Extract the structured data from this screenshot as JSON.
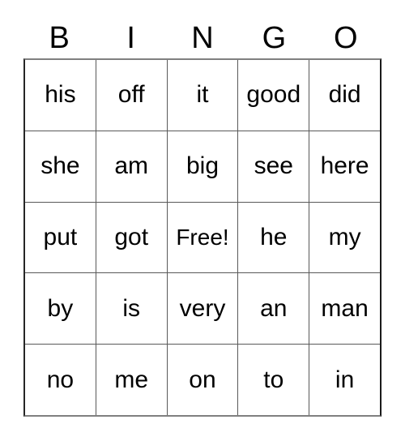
{
  "card": {
    "headers": [
      "B",
      "I",
      "N",
      "G",
      "O"
    ],
    "rows": [
      {
        "cells": [
          {
            "text": "his",
            "free": false
          },
          {
            "text": "off",
            "free": false
          },
          {
            "text": "it",
            "free": false
          },
          {
            "text": "good",
            "free": false
          },
          {
            "text": "did",
            "free": false
          }
        ]
      },
      {
        "cells": [
          {
            "text": "she",
            "free": false
          },
          {
            "text": "am",
            "free": false
          },
          {
            "text": "big",
            "free": false
          },
          {
            "text": "see",
            "free": false
          },
          {
            "text": "here",
            "free": false
          }
        ]
      },
      {
        "cells": [
          {
            "text": "put",
            "free": false
          },
          {
            "text": "got",
            "free": false
          },
          {
            "text": "Free!",
            "free": true
          },
          {
            "text": "he",
            "free": false
          },
          {
            "text": "my",
            "free": false
          }
        ]
      },
      {
        "cells": [
          {
            "text": "by",
            "free": false
          },
          {
            "text": "is",
            "free": false
          },
          {
            "text": "very",
            "free": false
          },
          {
            "text": "an",
            "free": false
          },
          {
            "text": "man",
            "free": false
          }
        ]
      },
      {
        "cells": [
          {
            "text": "no",
            "free": false
          },
          {
            "text": "me",
            "free": false
          },
          {
            "text": "on",
            "free": false
          },
          {
            "text": "to",
            "free": false
          },
          {
            "text": "in",
            "free": false
          }
        ]
      }
    ],
    "colors": {
      "background": "#ffffff",
      "text": "#000000",
      "grid_line": "#595959",
      "outer_border": "#808080"
    }
  }
}
